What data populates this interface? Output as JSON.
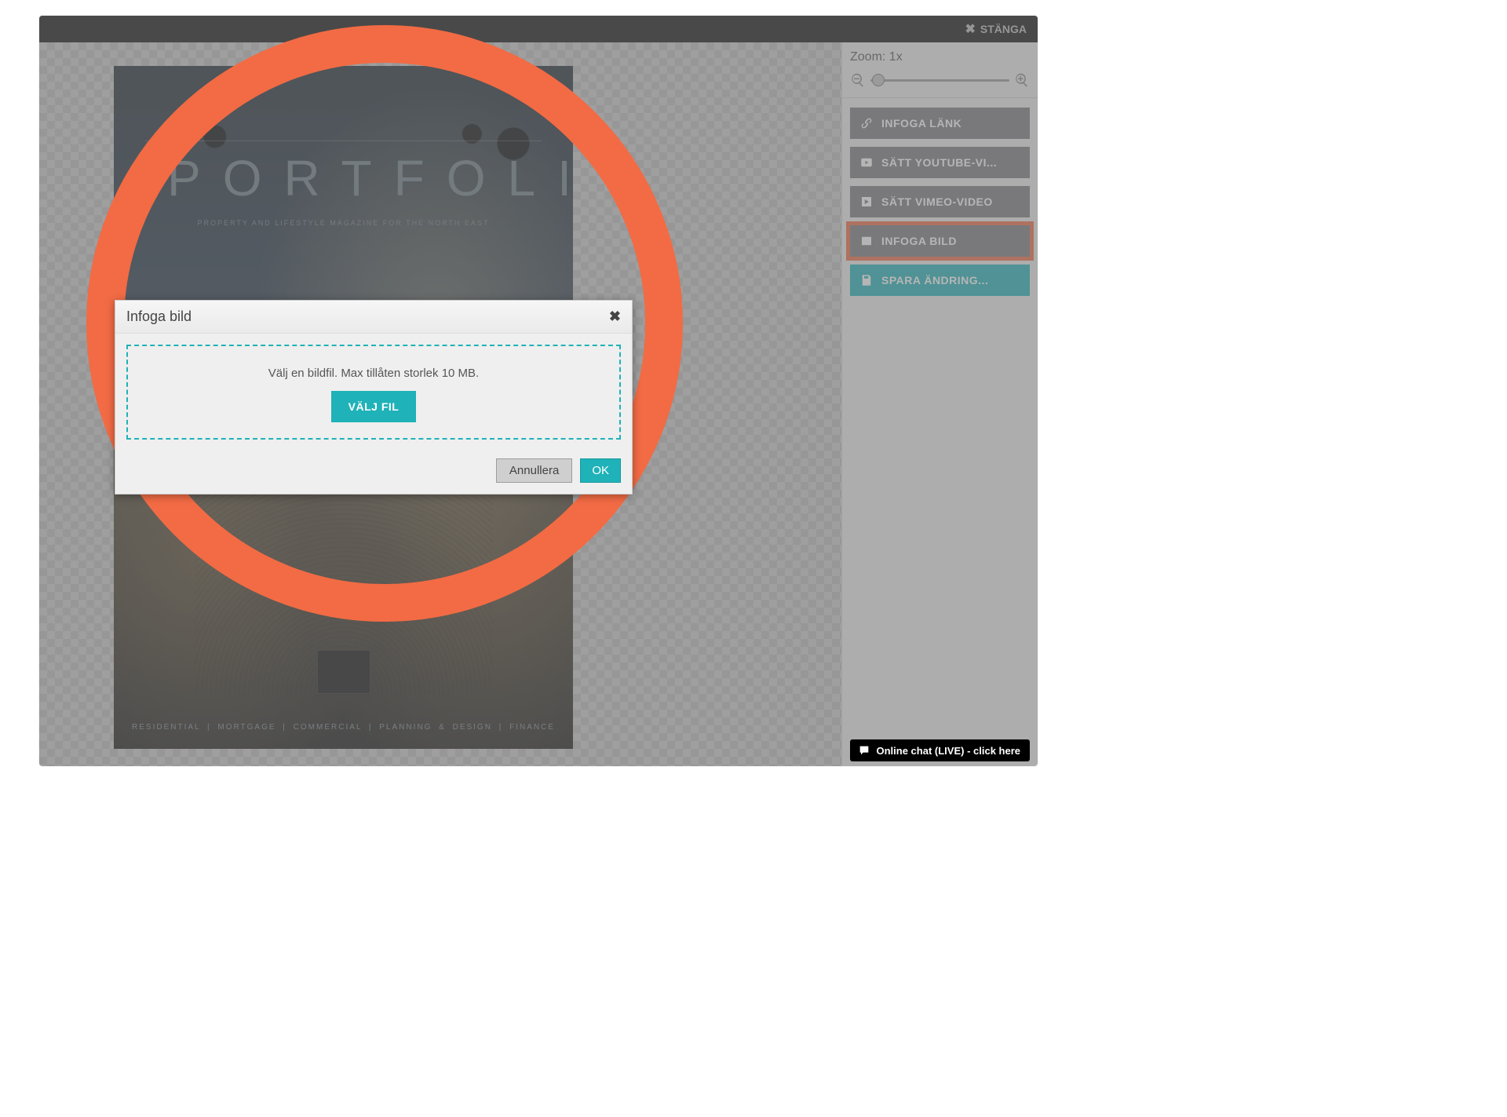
{
  "titlebar": {
    "close_label": "STÄNGA"
  },
  "magazine": {
    "title": "PORTFOLIO",
    "subtitle": "PROPERTY AND LIFESTYLE MAGAZINE FOR THE NORTH EAST",
    "footer": "RESIDENTIAL  |  MORTGAGE  |  COMMERCIAL  |  PLANNING & DESIGN  | FINANCE"
  },
  "sidebar": {
    "zoom_label": "Zoom: 1x",
    "buttons": {
      "link": "INFOGA LÄNK",
      "youtube": "SÄTT YOUTUBE-VI...",
      "vimeo": "SÄTT VIMEO-VIDEO",
      "image": "INFOGA BILD",
      "save": "SPARA ÄNDRING..."
    }
  },
  "dialog": {
    "title": "Infoga bild",
    "dropzone_text": "Välj en bildfil. Max tillåten storlek 10 MB.",
    "choose_file": "VÄLJ FIL",
    "cancel": "Annullera",
    "ok": "OK"
  },
  "chat": {
    "label": "Online chat (LIVE) - click here"
  },
  "colors": {
    "accent": "#1fb2b8",
    "highlight": "#f26b44"
  }
}
